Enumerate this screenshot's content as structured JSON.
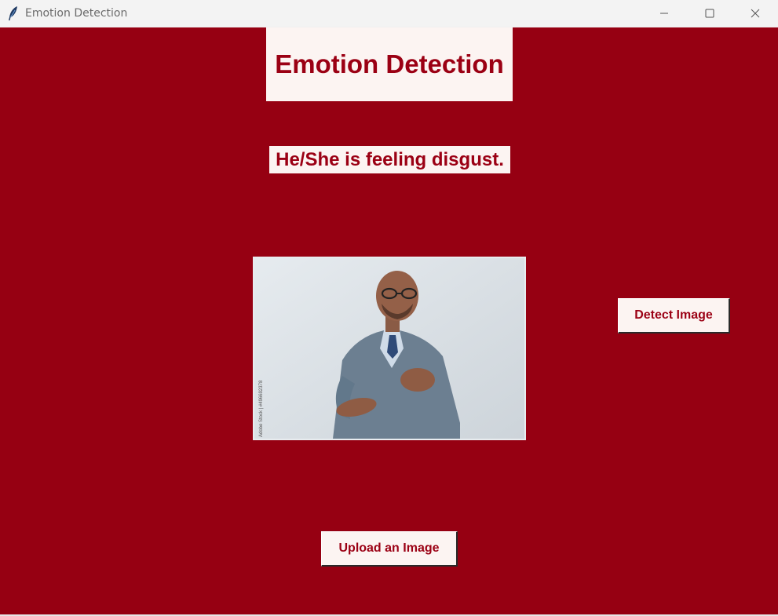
{
  "window": {
    "title": "Emotion Detection",
    "icon": "feather-icon"
  },
  "controls": {
    "minimize_icon": "minimize-icon",
    "maximize_icon": "maximize-icon",
    "close_icon": "close-icon"
  },
  "main": {
    "heading": "Emotion Detection",
    "result": "He/She is feeling disgust.",
    "detect_button": "Detect Image",
    "upload_button": "Upload an Image",
    "photo_watermark": "Adobe Stock | #496692378"
  },
  "colors": {
    "background": "#960012",
    "panel": "#fcf4f2",
    "accent_text": "#9b0014"
  }
}
